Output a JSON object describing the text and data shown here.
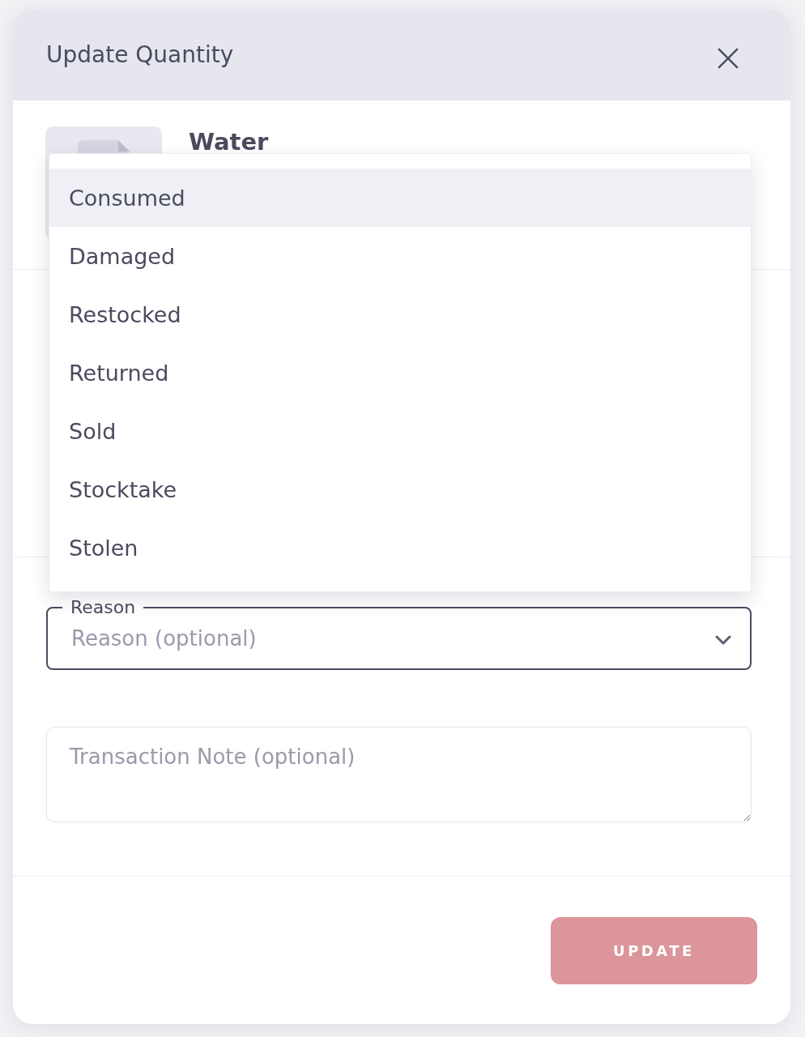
{
  "dialog": {
    "title": "Update Quantity"
  },
  "product": {
    "name": "Water"
  },
  "reason_menu": {
    "options": [
      {
        "label": "Consumed",
        "selected": true
      },
      {
        "label": "Damaged",
        "selected": false
      },
      {
        "label": "Restocked",
        "selected": false
      },
      {
        "label": "Returned",
        "selected": false
      },
      {
        "label": "Sold",
        "selected": false
      },
      {
        "label": "Stocktake",
        "selected": false
      },
      {
        "label": "Stolen",
        "selected": false
      }
    ]
  },
  "reason_field": {
    "label": "Reason",
    "placeholder": "Reason (optional)"
  },
  "note_field": {
    "placeholder": "Transaction Note (optional)"
  },
  "update_button": {
    "label": "UPDATE",
    "disabled": true
  }
}
